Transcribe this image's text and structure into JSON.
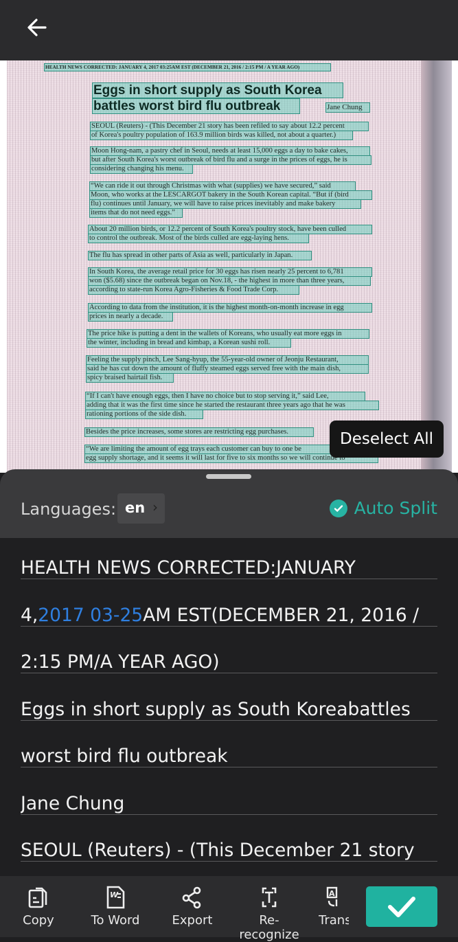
{
  "topbar": {
    "back_icon": "arrow-left-icon"
  },
  "document": {
    "header": "HEALTH NEWS CORRECTED: JANUARY 4, 2017 03:25AM EST (DECEMBER 21, 2016 / 2:15 PM / A YEAR AGO)",
    "title_lines": [
      "Eggs in short supply as South Korea",
      "battles worst bird flu outbreak"
    ],
    "author": "Jane Chung",
    "lines": [
      "SEOUL (Reuters) - (This December 21 story has been refiled to say about 12.2 percent",
      "of Korea's poultry population of 163.9 million birds was killed, not about a quarter.)",
      "Moon Hong-nam, a pastry chef in Seoul, needs at least 15,000 eggs a day to bake cakes,",
      "but after South Korea's worst outbreak of bird flu and a surge in the prices of eggs, he is",
      "considering changing his menu.",
      "“We can ride it out through Christmas with what (supplies) we have secured,” said",
      "Moon, who works at the LESCARGOT bakery in the South Korean capital. “But if (bird",
      "flu) continues until January, we will have to raise prices inevitably and make bakery",
      "items that do not need eggs.”",
      "About 20 million birds, or 12.2 percent of South Korea's poultry stock, have been culled",
      "to control the outbreak. Most of the birds culled are egg-laying hens.",
      "The flu has spread in other parts of Asia as well, particularly in Japan.",
      "In South Korea, the average retail price for 30 eggs has risen nearly 25 percent to 6,781",
      "won ($5.68) since the outbreak began on Nov.18, - the highest in more than three years,",
      "according to state-run Korea Agro-Fisheries & Food Trade Corp.",
      "According to data from the institution, it is the highest month-on-month increase in egg",
      "prices in nearly a decade.",
      "The price hike is putting a dent in the wallets of Koreans, who usually eat more eggs in",
      "the winter, including in bread and kimbap, a Korean sushi roll.",
      "Feeling the supply pinch, Lee Sang-hyup, the 55-year-old owner of Jeonju Restaurant,",
      "said he has cut down the amount of fluffy steamed eggs served free with the main dish,",
      "spicy braised hairtail fish.",
      "“If I can't have enough eggs, then I have no choice but to stop serving it,” said Lee,",
      "adding that it was the first time since he started the restaurant three years ago that he was",
      "rationing portions of the side dish.",
      "Besides the price increases, some stores are restricting egg purchases.",
      "“We are limiting the amount of egg trays each customer can buy to one be",
      "egg supply shortage, and it seems it will last for five to six months so we will continue to"
    ]
  },
  "tooltip": {
    "label": "Deselect All"
  },
  "languages": {
    "label": "Languages:",
    "value": "en"
  },
  "auto_split": {
    "label": "Auto Split",
    "checked": true,
    "color": "#27b3a3"
  },
  "recognized_text": {
    "rows": [
      {
        "text": "HEALTH NEWS CORRECTED:JANUARY"
      },
      {
        "before": "4,",
        "highlight": "2017 03-25",
        "after": "AM EST(DECEMBER 21, 2016 /",
        "highlight_color": "#2f7fe0"
      },
      {
        "text": "2:15 PM/A YEAR AGO)"
      },
      {
        "text": "Eggs in short supply as South Koreabattles"
      },
      {
        "text": "worst bird flu outbreak"
      },
      {
        "text": "Jane Chung"
      },
      {
        "text": "SEOUL (Reuters) - (This December 21 story"
      }
    ]
  },
  "toolbar": {
    "items": [
      {
        "label": "Copy",
        "icon": "copy-icon"
      },
      {
        "label": "To Word",
        "icon": "word-document-icon"
      },
      {
        "label": "Export",
        "icon": "share-icon"
      },
      {
        "label": "Re-recognize",
        "icon": "text-scan-icon"
      },
      {
        "label": "Trans",
        "icon": "translate-icon"
      }
    ],
    "confirm_icon": "checkmark-icon",
    "confirm_color": "#20b2a0"
  }
}
